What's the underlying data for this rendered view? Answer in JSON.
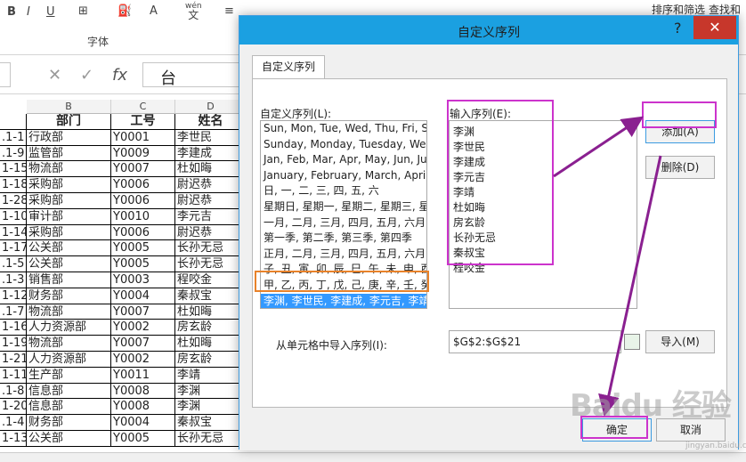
{
  "ribbon": {
    "bold": "B",
    "italic": "I",
    "underline": "U",
    "font_color": "A",
    "phonetic": "wén",
    "phonetic_char": "文",
    "group_font": "字体",
    "sort_filter": "排序和筛选",
    "find_select": "查找和"
  },
  "formula_bar": {
    "fx": "fx",
    "value": "台"
  },
  "sheet": {
    "columns": [
      "B",
      "C",
      "D"
    ],
    "header": {
      "a": "",
      "b": "部门",
      "c": "工号",
      "d": "姓名"
    },
    "rows": [
      {
        "a": ".1-1",
        "b": "行政部",
        "c": "Y0001",
        "d": "李世民"
      },
      {
        "a": ".1-9",
        "b": "监管部",
        "c": "Y0009",
        "d": "李建成"
      },
      {
        "a": "1-15",
        "b": "物流部",
        "c": "Y0007",
        "d": "杜如晦"
      },
      {
        "a": "1-18",
        "b": "采购部",
        "c": "Y0006",
        "d": "尉迟恭"
      },
      {
        "a": "1-28",
        "b": "采购部",
        "c": "Y0006",
        "d": "尉迟恭"
      },
      {
        "a": "1-10",
        "b": "审计部",
        "c": "Y0010",
        "d": "李元吉"
      },
      {
        "a": "1-14",
        "b": "采购部",
        "c": "Y0006",
        "d": "尉迟恭"
      },
      {
        "a": "1-17",
        "b": "公关部",
        "c": "Y0005",
        "d": "长孙无忌"
      },
      {
        "a": ".1-5",
        "b": "公关部",
        "c": "Y0005",
        "d": "长孙无忌"
      },
      {
        "a": ".1-3",
        "b": "销售部",
        "c": "Y0003",
        "d": "程咬金"
      },
      {
        "a": "1-12",
        "b": "财务部",
        "c": "Y0004",
        "d": "秦叔宝"
      },
      {
        "a": ".1-7",
        "b": "物流部",
        "c": "Y0007",
        "d": "杜如晦"
      },
      {
        "a": "1-16",
        "b": "人力资源部",
        "c": "Y0002",
        "d": "房玄龄"
      },
      {
        "a": "1-19",
        "b": "物流部",
        "c": "Y0007",
        "d": "杜如晦"
      },
      {
        "a": "1-21",
        "b": "人力资源部",
        "c": "Y0002",
        "d": "房玄龄"
      },
      {
        "a": "1-11",
        "b": "生产部",
        "c": "Y0011",
        "d": "李靖"
      },
      {
        "a": ".1-8",
        "b": "信息部",
        "c": "Y0008",
        "d": "李渊"
      },
      {
        "a": "1-20",
        "b": "信息部",
        "c": "Y0008",
        "d": "李渊"
      },
      {
        "a": ".1-4",
        "b": "财务部",
        "c": "Y0004",
        "d": "秦叔宝"
      },
      {
        "a": "1-13",
        "b": "公关部",
        "c": "Y0005",
        "d": "长孙无忌"
      }
    ]
  },
  "dialog": {
    "title": "自定义序列",
    "help": "?",
    "close": "✕",
    "tab": "自定义序列",
    "custom_lists_label": "自定义序列(L):",
    "entries_label": "输入序列(E):",
    "custom_lists": [
      "Sun, Mon, Tue, Wed, Thu, Fri, Sat",
      "Sunday, Monday, Tuesday, Wednesday",
      "Jan, Feb, Mar, Apr, May, Jun, Jul",
      "January, February, March, April",
      "日, 一, 二, 三, 四, 五, 六",
      "星期日, 星期一, 星期二, 星期三, 星期四",
      "一月, 二月, 三月, 四月, 五月, 六月, 七月",
      "第一季, 第二季, 第三季, 第四季",
      "正月, 二月, 三月, 四月, 五月, 六月, 七月",
      "子, 丑, 寅, 卯, 辰, 巳, 午, 未, 申, 酉",
      "甲, 乙, 丙, 丁, 戊, 己, 庚, 辛, 壬, 癸",
      "李渊, 李世民, 李建成, 李元吉, 李靖"
    ],
    "entries": [
      "李渊",
      "李世民",
      "李建成",
      "李元吉",
      "李靖",
      "杜如晦",
      "房玄龄",
      "长孙无忌",
      "秦叔宝",
      "程咬金"
    ],
    "add_button": "添加(A)",
    "delete_button": "删除(D)",
    "import_label": "从单元格中导入序列(I):",
    "import_range": "$G$2:$G$21",
    "import_button": "导入(M)",
    "ok_button": "确定",
    "cancel_button": "取消"
  },
  "colors": {
    "title_bar": "#1ba0e1",
    "close_button": "#c7372b",
    "highlight_magenta": "#cc33cc",
    "highlight_orange": "#e8822a",
    "arrow_purple": "#8a2090",
    "selection": "#3399ff"
  },
  "watermark": {
    "text": "Baidu 经验",
    "sub": "jingyan.baidu.com"
  }
}
